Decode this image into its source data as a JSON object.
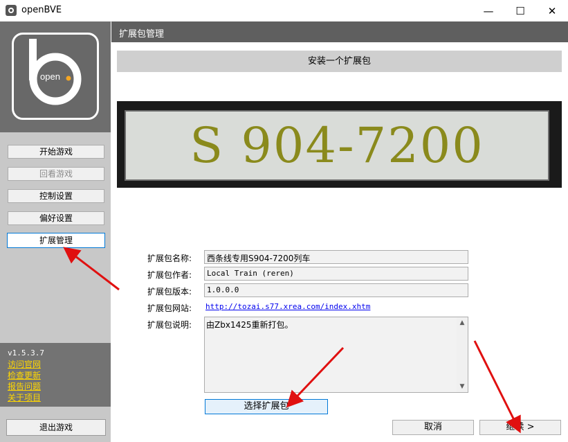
{
  "window": {
    "title": "openBVE",
    "controls": {
      "minimize": "—",
      "maximize": "☐",
      "close": "✕"
    }
  },
  "logo": {
    "text": "open"
  },
  "sidebar": {
    "buttons": [
      {
        "label": "开始游戏",
        "state": "normal"
      },
      {
        "label": "回看游戏",
        "state": "disabled"
      },
      {
        "label": "控制设置",
        "state": "normal"
      },
      {
        "label": "偏好设置",
        "state": "normal"
      },
      {
        "label": "扩展管理",
        "state": "active"
      }
    ],
    "version": "v1.5.3.7",
    "links": [
      "访问官网",
      "检查更新",
      "报告问题",
      "关于项目"
    ],
    "exit_label": "退出游戏"
  },
  "main": {
    "header_title": "扩展包管理",
    "subheader": "安装一个扩展包",
    "preview_text": "S 904-7200",
    "fields": {
      "name_label": "扩展包名称:",
      "name_value": "西条线专用S904-7200列车",
      "author_label": "扩展包作者:",
      "author_value": "Local Train (reren)",
      "version_label": "扩展包版本:",
      "version_value": "1.0.0.0",
      "website_label": "扩展包网站:",
      "website_value": "http://tozai.s77.xrea.com/index.xhtm",
      "description_label": "扩展包说明:",
      "description_value": "由Zbx1425重新打包。"
    },
    "select_button": "选择扩展包",
    "cancel_button": "取消",
    "continue_button": "继续 >"
  },
  "colors": {
    "accent": "#0078d7",
    "link_yellow": "#ffd700",
    "header_gray": "#5f5f5f",
    "preview_text": "#8a8a1c",
    "annotation_red": "#e01010"
  }
}
